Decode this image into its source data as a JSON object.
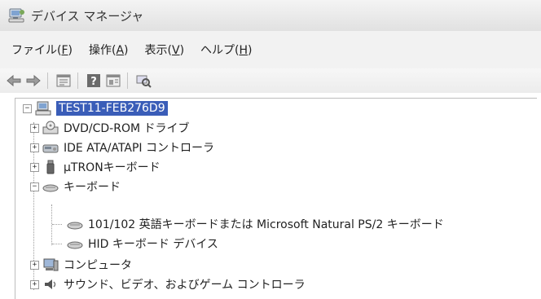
{
  "window": {
    "title": "デバイス マネージャ",
    "selected_color": "#3a5db8"
  },
  "menu": {
    "items": [
      {
        "label": "ファイル(",
        "acc": "F",
        "tail": ")"
      },
      {
        "label": "操作(",
        "acc": "A",
        "tail": ")"
      },
      {
        "label": "表示(",
        "acc": "V",
        "tail": ")"
      },
      {
        "label": "ヘルプ(",
        "acc": "H",
        "tail": ")"
      }
    ]
  },
  "toolbar": {
    "buttons": [
      "back-icon",
      "forward-icon",
      "properties-icon",
      "help-icon",
      "update-driver-icon",
      "scan-hardware-icon"
    ]
  },
  "tree": {
    "root": {
      "label": "TEST11-FEB276D9",
      "expander": "−",
      "icon": "computer-icon"
    },
    "nodes": [
      {
        "label": "DVD/CD-ROM ドライブ",
        "expander": "+",
        "icon": "dvd-drive-icon"
      },
      {
        "label": "IDE ATA/ATAPI コントローラ",
        "expander": "+",
        "icon": "ide-controller-icon"
      },
      {
        "label": "μTRONキーボード",
        "expander": "+",
        "icon": "usb-device-icon"
      },
      {
        "label": "キーボード",
        "expander": "−",
        "icon": "keyboard-icon"
      },
      {
        "label": "101/102 英語キーボードまたは Microsoft Natural PS/2 キーボード",
        "icon": "keyboard-icon"
      },
      {
        "label": "HID キーボード デバイス",
        "icon": "keyboard-icon"
      },
      {
        "label": "コンピュータ",
        "expander": "+",
        "icon": "computer-icon"
      },
      {
        "label": "サウンド、ビデオ、およびゲーム コントローラ",
        "expander": "+",
        "icon": "speaker-icon"
      }
    ]
  }
}
